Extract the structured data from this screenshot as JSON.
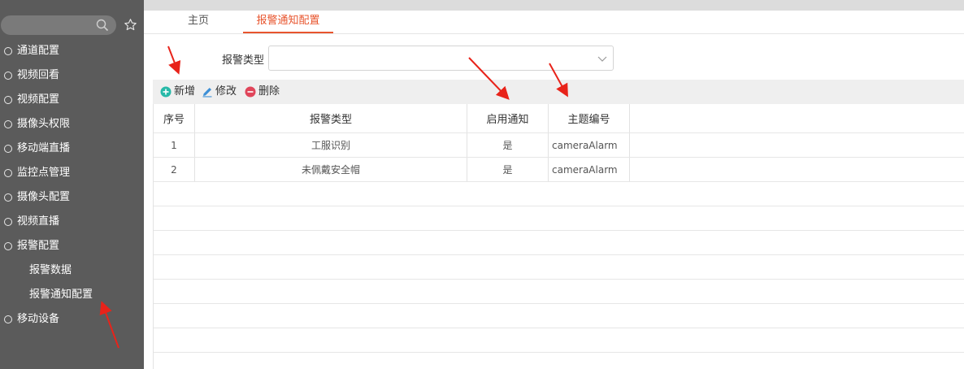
{
  "sidebar": {
    "search": {
      "placeholder": ""
    },
    "items": [
      {
        "label": "通道配置"
      },
      {
        "label": "视频回看"
      },
      {
        "label": "视频配置"
      },
      {
        "label": "摄像头权限"
      },
      {
        "label": "移动端直播"
      },
      {
        "label": "监控点管理"
      },
      {
        "label": "摄像头配置"
      },
      {
        "label": "视频直播"
      },
      {
        "label": "报警配置"
      },
      {
        "label": "报警数据"
      },
      {
        "label": "报警通知配置"
      },
      {
        "label": "移动设备"
      }
    ]
  },
  "tabs": [
    {
      "label": "主页"
    },
    {
      "label": "报警通知配置"
    }
  ],
  "filter": {
    "label": "报警类型",
    "value": ""
  },
  "toolbar": {
    "add_label": "新增",
    "edit_label": "修改",
    "delete_label": "删除"
  },
  "table": {
    "columns": [
      "序号",
      "报警类型",
      "启用通知",
      "主题编号"
    ],
    "rows": [
      [
        "1",
        "工服识别",
        "是",
        "cameraAlarm"
      ],
      [
        "2",
        "未佩戴安全帽",
        "是",
        "cameraAlarm"
      ]
    ]
  },
  "colors": {
    "sidebar_bg": "#5b5b5b",
    "accent": "#e8552e",
    "add_icon": "#27b9a8",
    "edit_icon": "#3c8fd6",
    "delete_icon": "#e0455a",
    "annotation_arrow": "#e8231a"
  },
  "icons": [
    "search-icon",
    "star-icon",
    "chevron-down-icon",
    "plus-circle-icon",
    "pencil-icon",
    "minus-circle-icon"
  ]
}
